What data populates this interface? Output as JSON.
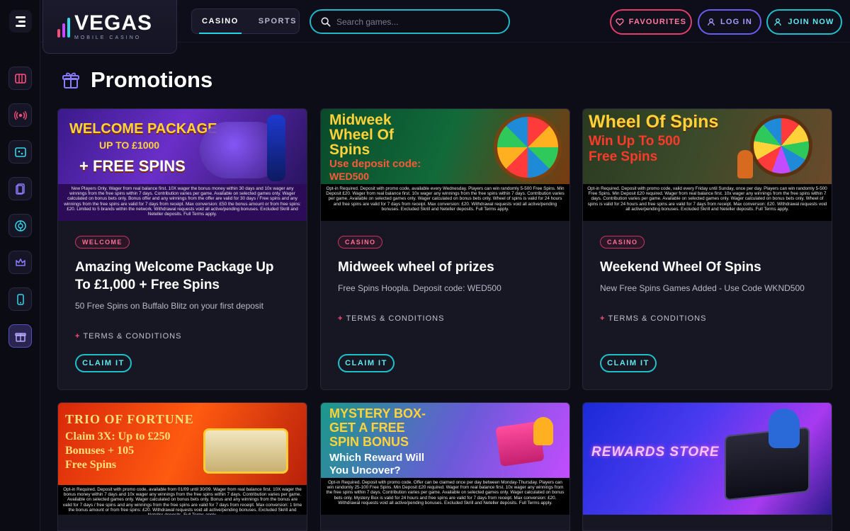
{
  "logo": {
    "main": "VEGAS",
    "sub": "MOBILE CASINO"
  },
  "nav": {
    "tabs": [
      {
        "label": "CASINO"
      },
      {
        "label": "SPORTS"
      }
    ]
  },
  "search": {
    "placeholder": "Search games..."
  },
  "header_buttons": {
    "favourites": "FAVOURITES",
    "login": "LOG IN",
    "join": "JOIN NOW"
  },
  "page_title": "Promotions",
  "promotions": [
    {
      "banner_lines": [
        "WELCOME PACKAGE",
        "UP TO £1000",
        "+ FREE SPINS"
      ],
      "banner_terms": "New Players Only. Wager from real balance first. 10X wager the bonus money within 30 days and 10x wager any winnings from the free spins within 7 days. Contribution varies per game. Available on selected games only. Wager calculated on bonus bets only. Bonus offer and any winnings from the offer are valid for 30 days / Free spins and any winnings from the free spins are valid for 7 days from receipt. Max conversion: £50 the bonus amount or from free spins: £20. Limited to 5 brands within the network. Withdrawal requests void all active/pending bonuses. Excluded Skrill and Neteller deposits. Full Terms apply.",
      "badge": "WELCOME",
      "title": "Amazing Welcome Package Up To £1,000 + Free Spins",
      "desc": "50 Free Spins on Buffalo Blitz on your first deposit",
      "terms_label": "TERMS & CONDITIONS",
      "cta": "CLAIM IT"
    },
    {
      "banner_lines": [
        "Midweek",
        "Wheel Of",
        "Spins",
        "Use deposit code:",
        "WED500"
      ],
      "banner_terms": "Opt-in Required. Deposit with promo code, available every Wednesday. Players can win randomly 5-500 Free Spins. Min Deposit £20. Wager from real balance first. 10x wager any winnings from the free spins within 7 days. Contribution varies per game. Available on selected games only. Wager calculated on bonus bets only. Wheel of spins is valid for 24 hours and free spins are valid for 7 days from receipt. Max conversion: £20. Withdrawal requests void all active/pending bonuses. Excluded Skrill and Neteller deposits. Full Terms apply.",
      "badge": "CASINO",
      "title": "Midweek wheel of prizes",
      "desc": "Free Spins Hoopla. Deposit code: WED500",
      "terms_label": "TERMS & CONDITIONS",
      "cta": "CLAIM IT"
    },
    {
      "banner_lines": [
        "Wheel Of Spins",
        "Win Up To 500",
        "Free Spins"
      ],
      "banner_terms": "Opt-in Required. Deposit with promo code, valid every Friday until Sunday, once per day. Players can win randomly 5-500 Free Spins. Min Deposit £20 required. Wager from real balance first. 10x wager any winnings from the free spins within 7 days. Contribution varies per game. Available on selected games only. Wager calculated on bonus bets only. Wheel of spins is valid for 24 hours and free spins are valid for 7 days from receipt. Max conversion: £20. Withdrawal requests void all active/pending bonuses. Excluded Skrill and Neteller deposits. Full Terms apply.",
      "badge": "CASINO",
      "title": "Weekend Wheel Of Spins",
      "desc": "New Free Spins Games Added - Use Code WKND500",
      "terms_label": "TERMS & CONDITIONS",
      "cta": "CLAIM IT"
    },
    {
      "banner_lines": [
        "TRIO OF FORTUNE",
        "Claim 3X: Up to £250",
        "Bonuses + 105",
        "Free Spins"
      ],
      "banner_terms": "Opt-in Required. Deposit with promo code, available from 01/09 until 30/09. Wager from real balance first. 10X wager the bonus money within 7 days and 10x wager any winnings from the free spins within 7 days. Contribution varies per game. Available on selected games only. Wager calculated on bonus bets only. Bonus and any winnings from the bonus are valid for 7 days / free spins and any winnings from the free spins are valid for 7 days from receipt. Max conversion: 1 time the bonus amount or from free spins: £20. Withdrawal requests void all active/pending bonuses. Excluded Skrill and Neteller deposits. Full Terms apply."
    },
    {
      "banner_lines": [
        "MYSTERY BOX-",
        "GET A FREE",
        "SPIN BONUS",
        "Which Reward Will",
        "You Uncover?"
      ],
      "banner_terms": "Opt-in Required. Deposit with promo code. Offer can be claimed once per day between Monday-Thursday. Players can win randomly 25-100 Free Spins. Min Deposit £20 required. Wager from real balance first. 10x wager any winnings from the free spins within 7 days. Contribution varies per game. Available on selected games only. Wager calculated on bonus bets only. Mystery Box is valid for 24 hours and free spins are valid for 7 days from receipt. Max conversion: £20. Withdrawal requests void all active/pending bonuses. Excluded Skrill and Neteller deposits. Full Terms apply."
    },
    {
      "banner_lines": [
        "REWARDS STORE"
      ]
    }
  ]
}
